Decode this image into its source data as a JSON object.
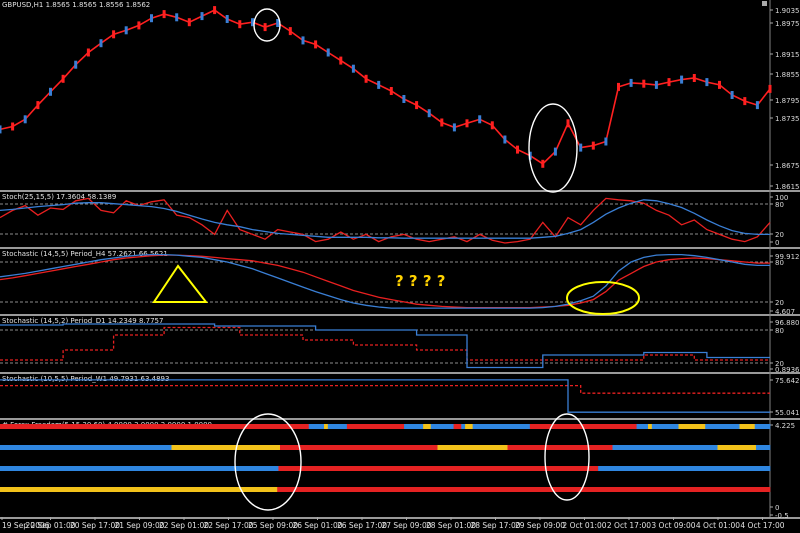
{
  "chart_data": {
    "type": "line",
    "symbol": "GBPUSD,H1",
    "x_ticks": [
      "19 Sep 2006",
      "20 Sep 01:00",
      "20 Sep 17:00",
      "21 Sep 09:00",
      "22 Sep 01:00",
      "22 Sep 17:00",
      "25 Sep 09:00",
      "26 Sep 01:00",
      "26 Sep 17:00",
      "27 Sep 09:00",
      "28 Sep 01:00",
      "28 Sep 17:00",
      "29 Sep 09:00",
      "2 Oct 01:00",
      "2 Oct 17:00",
      "3 Oct 09:00",
      "4 Oct 01:00",
      "4 Oct 17:00"
    ],
    "panels": [
      {
        "name": "price",
        "header": "GBPUSD,H1  1.8565 1.8565 1.8556 1.8562",
        "ylim": [
          1.8605,
          1.9055
        ],
        "y_ticks": [
          "1.9035",
          "1.8975",
          "1.8915",
          "1.8855",
          "1.8795",
          "1.8735",
          "1.8675",
          "1.8615"
        ],
        "series": [
          {
            "color": "#ff2020",
            "values": [
              1.8745,
              1.8752,
              1.877,
              1.8805,
              1.8838,
              1.887,
              1.8905,
              1.8935,
              1.8958,
              1.898,
              1.899,
              1.9002,
              1.902,
              1.903,
              1.9022,
              1.901,
              1.9025,
              1.904,
              1.9018,
              1.9005,
              1.901,
              1.8998,
              1.9008,
              1.8988,
              1.8965,
              1.8955,
              1.8935,
              1.8915,
              1.8895,
              1.887,
              1.8855,
              1.884,
              1.882,
              1.8805,
              1.8785,
              1.8762,
              1.875,
              1.876,
              1.877,
              1.8755,
              1.872,
              1.8695,
              1.868,
              1.866,
              1.869,
              1.876,
              1.87,
              1.8705,
              1.8715,
              1.885,
              1.886,
              1.8858,
              1.8855,
              1.8862,
              1.8868,
              1.8872,
              1.8862,
              1.8855,
              1.883,
              1.8815,
              1.8805,
              1.8845
            ]
          }
        ]
      },
      {
        "name": "stoch_25_15_5",
        "header": "Stoch(25,15,5) 17.3604 58.1389",
        "ylim": [
          0,
          100
        ],
        "y_ticks": [
          "100",
          "80",
          "20",
          "0"
        ],
        "levels": [
          80,
          20
        ],
        "series": [
          {
            "color": "#e82020",
            "values": [
              55,
              70,
              80,
              60,
              75,
              72,
              90,
              95,
              70,
              65,
              90,
              80,
              88,
              92,
              60,
              55,
              40,
              20,
              70,
              30,
              20,
              10,
              30,
              25,
              20,
              5,
              10,
              25,
              10,
              20,
              5,
              15,
              20,
              10,
              5,
              10,
              15,
              5,
              20,
              8,
              2,
              5,
              10,
              45,
              15,
              55,
              40,
              70,
              95,
              92,
              90,
              85,
              70,
              60,
              40,
              50,
              30,
              20,
              10,
              5,
              15,
              45
            ]
          },
          {
            "color": "#3a7fd5",
            "values": [
              70,
              72,
              75,
              78,
              80,
              82,
              85,
              86,
              86,
              84,
              82,
              80,
              78,
              74,
              68,
              60,
              52,
              45,
              40,
              36,
              30,
              26,
              22,
              20,
              18,
              16,
              14,
              14,
              14,
              14,
              13,
              13,
              12,
              12,
              12,
              12,
              12,
              12,
              12,
              12,
              12,
              12,
              12,
              14,
              16,
              22,
              30,
              45,
              62,
              75,
              85,
              92,
              90,
              84,
              76,
              64,
              50,
              38,
              28,
              22,
              20,
              20
            ]
          }
        ]
      },
      {
        "name": "stoch_h4",
        "header": "Stochastic (14,5,5) Period_H4 57.2621 66.5621",
        "ylim": [
          0,
          100
        ],
        "y_ticks": [
          "99.9122",
          "80",
          "20",
          "4.607"
        ],
        "levels": [
          80,
          20
        ],
        "series": [
          {
            "color": "#e82020",
            "values": [
              55,
              58,
              62,
              66,
              70,
              74,
              78,
              82,
              86,
              90,
              93,
              95,
              97,
              98,
              98,
              97,
              96,
              94,
              92,
              90,
              88,
              84,
              80,
              74,
              68,
              60,
              52,
              44,
              36,
              30,
              24,
              20,
              16,
              12,
              10,
              8,
              7,
              6,
              6,
              6,
              6,
              6,
              6,
              7,
              8,
              10,
              14,
              20,
              34,
              54,
              66,
              78,
              86,
              90,
              92,
              93,
              92,
              90,
              88,
              86,
              84,
              84
            ]
          },
          {
            "color": "#3a7fd5",
            "values": [
              60,
              63,
              66,
              70,
              74,
              78,
              82,
              86,
              90,
              93,
              96,
              98,
              99,
              99,
              98,
              96,
              94,
              90,
              86,
              80,
              74,
              66,
              58,
              50,
              42,
              34,
              27,
              20,
              14,
              10,
              7,
              5,
              5,
              5,
              5,
              5,
              5,
              5,
              5,
              5,
              5,
              5,
              5,
              6,
              8,
              12,
              18,
              26,
              44,
              70,
              86,
              94,
              98,
              99,
              99,
              97,
              94,
              90,
              86,
              82,
              80,
              80
            ]
          }
        ]
      },
      {
        "name": "stoch_d1",
        "header": "Stochastic (14,5,2) Period_D1 14.2349 8.7757",
        "ylim": [
          0,
          100
        ],
        "y_ticks": [
          "96.8807",
          "80",
          "20",
          "0.8936"
        ],
        "levels": [
          80,
          20
        ],
        "series": [
          {
            "color": "#e82020",
            "values": [
              20,
              20,
              20,
              20,
              20,
              40,
              40,
              40,
              40,
              70,
              70,
              70,
              70,
              85,
              85,
              85,
              85,
              85,
              85,
              70,
              70,
              70,
              70,
              70,
              60,
              60,
              60,
              60,
              50,
              50,
              50,
              50,
              50,
              40,
              40,
              40,
              40,
              20,
              20,
              20,
              20,
              20,
              20,
              20,
              20,
              20,
              20,
              20,
              20,
              20,
              20,
              30,
              30,
              30,
              30,
              20,
              20,
              20,
              20,
              20,
              20,
              20
            ]
          },
          {
            "color": "#3a7fd5",
            "values": [
              90,
              90,
              90,
              90,
              90,
              92,
              92,
              92,
              92,
              92,
              92,
              92,
              92,
              92,
              92,
              92,
              92,
              88,
              88,
              88,
              88,
              88,
              88,
              88,
              88,
              80,
              80,
              80,
              80,
              80,
              80,
              80,
              80,
              70,
              70,
              70,
              70,
              5,
              5,
              5,
              5,
              5,
              5,
              30,
              30,
              30,
              30,
              30,
              30,
              30,
              30,
              35,
              35,
              35,
              35,
              35,
              25,
              25,
              25,
              25,
              25,
              25
            ]
          }
        ]
      },
      {
        "name": "stoch_w1",
        "header": "Stochastic (10,5,5) Period_W1 49.7931 63.4893",
        "ylim": [
          0,
          100
        ],
        "y_ticks": [
          "75.6422",
          "55.0418"
        ],
        "series": [
          {
            "color": "#e82020",
            "values": [
              80,
              80,
              80,
              80,
              80,
              80,
              80,
              80,
              80,
              80,
              80,
              80,
              80,
              80,
              80,
              80,
              80,
              80,
              80,
              80,
              80,
              80,
              80,
              80,
              80,
              80,
              80,
              80,
              80,
              80,
              80,
              80,
              80,
              80,
              80,
              80,
              80,
              80,
              80,
              80,
              80,
              80,
              80,
              80,
              80,
              80,
              60,
              60,
              60,
              60,
              60,
              60,
              60,
              60,
              60,
              60,
              60,
              60,
              60,
              60,
              60,
              60
            ]
          },
          {
            "color": "#3a7fd5",
            "values": [
              95,
              95,
              95,
              95,
              95,
              95,
              95,
              95,
              95,
              95,
              95,
              95,
              95,
              95,
              95,
              95,
              95,
              95,
              95,
              95,
              95,
              95,
              95,
              95,
              95,
              95,
              95,
              95,
              95,
              95,
              95,
              95,
              95,
              95,
              95,
              95,
              95,
              95,
              95,
              95,
              95,
              95,
              95,
              95,
              95,
              10,
              10,
              10,
              10,
              10,
              10,
              10,
              10,
              10,
              10,
              10,
              10,
              10,
              10,
              10,
              10,
              10
            ]
          }
        ]
      },
      {
        "name": "forex_freedom",
        "header": "# Forex Freedom(5,15,30,60) 4.0000 3.0000 2.0000 1.0000",
        "y_ticks": [
          "4.225",
          "0",
          "-0.5"
        ],
        "palette": {
          "R": "#e52222",
          "B": "#2f86e0",
          "Y": "#f2c21a"
        },
        "rows": [
          "RRRRRRRRRRRRRRRRRRRRRRRRRRRRRRRRRRRRRRRRRRRRRRRRRRRRRRRRRRRRRRRRRRRRRRRRRRRRRRRRRBBBBYBBBBBRRRRRRRRRRRRRRRBBBBBYYBBBBBBRRBYYBBBBBBBBBBBBBBBRRRRRRRRRRRRRRRRRRRRRRRRRRRRBBBYBBBBBBBYYYYYYYBBBBBBBBBYYYYBBBB",
          "BBBBBBBBBBBBBBBBBBBBBBBBBBBBBBBBBBBBBBBBBBBBBBBBBYYYYYYYYYYYYYYYYYYYYYYYYYYYYYYYRRRRRRRRRRRRRRRRRRRRRRRRRRRRRRRRRRRRRRRRRRRRRYYYYYYYYYYYYYYYYYYYYRRRRRRRRRRRRRRRRRRRRRRRRRRRRRRBBBBBBBBBBBBBBBBBBBBBBBBBBBBBBYYYYYYYYYYYBBBB",
          "BBBBBBBBBBBBBBBBBBBBBBBBBBBBBBBBBBBBBBBBBBBBBBBBBBBBBBBBBBBBBBBBBBBBBBBBBBBBBBBBBRRRRRRRRRRRRRRRRRRRRRRRRRRRRRRRRRRRRRRRRRRRRRRRRRRRRRRRRRRRRRRRRRRRRRRRRRRRRRRRRRRRRRRRRRRRRRBBBBBBBBBBBBBBBBBBBBBBBBBBBBBBBBBBBBBBBBBBBBBBBBBB",
          "YYYYYYYYYYYYYYYYYYYYYYYYYYYYYYYYYYYYYYYYYYYYYYYYYYYYYYYYYYYYYYYYYYYYYYYYYYYYYYYYYRRRRRRRRRRRRRRRRRRRRRRRRRRRRRRRRRRRRRRRRRRRRRRRRRRRRRRRRRRRRRRRRRRRRRRRRRRRRRRRRRRRRRRRRRRRRRRRRRRRRRRRRRRRRRRRRRRRRRRRRRRRRRRRRRRRRRRRRRRRRRRRR"
        ]
      }
    ],
    "annotations": [
      {
        "kind": "ellipse",
        "stroke": "#ffffff",
        "panel": "price"
      },
      {
        "kind": "ellipse",
        "stroke": "#ffffff",
        "panel": "price"
      },
      {
        "kind": "triangle",
        "stroke": "#ffff00",
        "panel": "stoch_h4"
      },
      {
        "kind": "text",
        "text": "?  ?  ?  ?",
        "color": "#ffd200",
        "panel": "stoch_h4"
      },
      {
        "kind": "ellipse",
        "stroke": "#ffff00",
        "panel": "stoch_h4"
      },
      {
        "kind": "ellipse",
        "stroke": "#ffffff",
        "panel": "forex_freedom"
      },
      {
        "kind": "ellipse",
        "stroke": "#ffffff",
        "panel": "forex_freedom"
      }
    ]
  }
}
